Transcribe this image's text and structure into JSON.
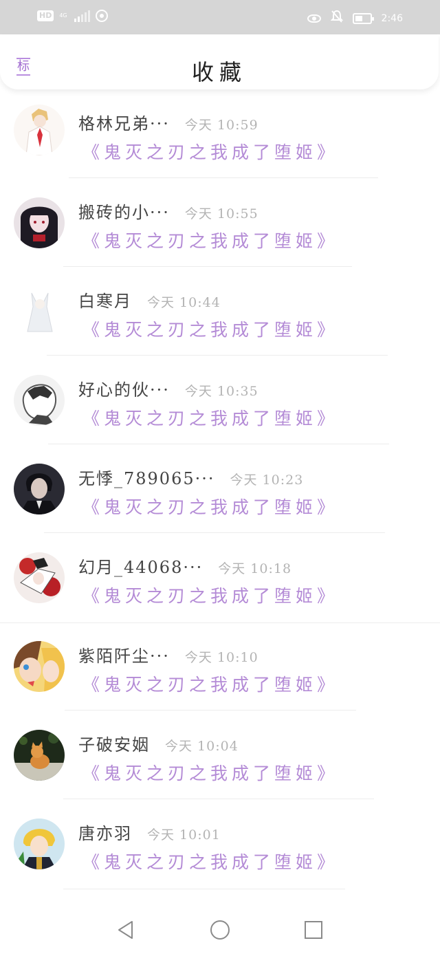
{
  "status_bar": {
    "hd_label": "HD",
    "network_label": "4G",
    "time": "2:46"
  },
  "header": {
    "left_label": "标",
    "title": "收藏"
  },
  "items": [
    {
      "name": "格林兄弟···",
      "time": "今天 10:59",
      "book": "《鬼灭之刃之我成了堕姬》",
      "avatar": "anime-boy-red-tie-avatar"
    },
    {
      "name": "搬砖的小···",
      "time": "今天 10:55",
      "book": "《鬼灭之刃之我成了堕姬》",
      "avatar": "dark-hair-girl-avatar"
    },
    {
      "name": "白寒月",
      "time": "今天 10:44",
      "book": "《鬼灭之刃之我成了堕姬》",
      "avatar": "white-hair-figure-avatar"
    },
    {
      "name": "好心的伙···",
      "time": "今天 10:35",
      "book": "《鬼灭之刃之我成了堕姬》",
      "avatar": "sketch-character-avatar"
    },
    {
      "name": "无悸_789065···",
      "time": "今天 10:23",
      "book": "《鬼灭之刃之我成了堕姬》",
      "avatar": "dark-suit-man-avatar"
    },
    {
      "name": "幻月_44068···",
      "time": "今天 10:18",
      "book": "《鬼灭之刃之我成了堕姬》",
      "avatar": "red-white-anime-avatar"
    },
    {
      "name": "紫陌阡尘···",
      "time": "今天 10:10",
      "book": "《鬼灭之刃之我成了堕姬》",
      "avatar": "blonde-couple-avatar"
    },
    {
      "name": "子破安姻",
      "time": "今天 10:04",
      "book": "《鬼灭之刃之我成了堕姬》",
      "avatar": "orange-cat-avatar"
    },
    {
      "name": "唐亦羽",
      "time": "今天 10:01",
      "book": "《鬼灭之刃之我成了堕姬》",
      "avatar": "blonde-boy-avatar"
    }
  ],
  "colors": {
    "accent": "#b48bd6",
    "status_bar_bg": "#d6d6d6",
    "name_text": "#444444",
    "time_text": "#b3b3b3"
  },
  "nav_bar": {
    "back_icon": "triangle-back-icon",
    "home_icon": "circle-home-icon",
    "recent_icon": "square-recent-icon"
  }
}
